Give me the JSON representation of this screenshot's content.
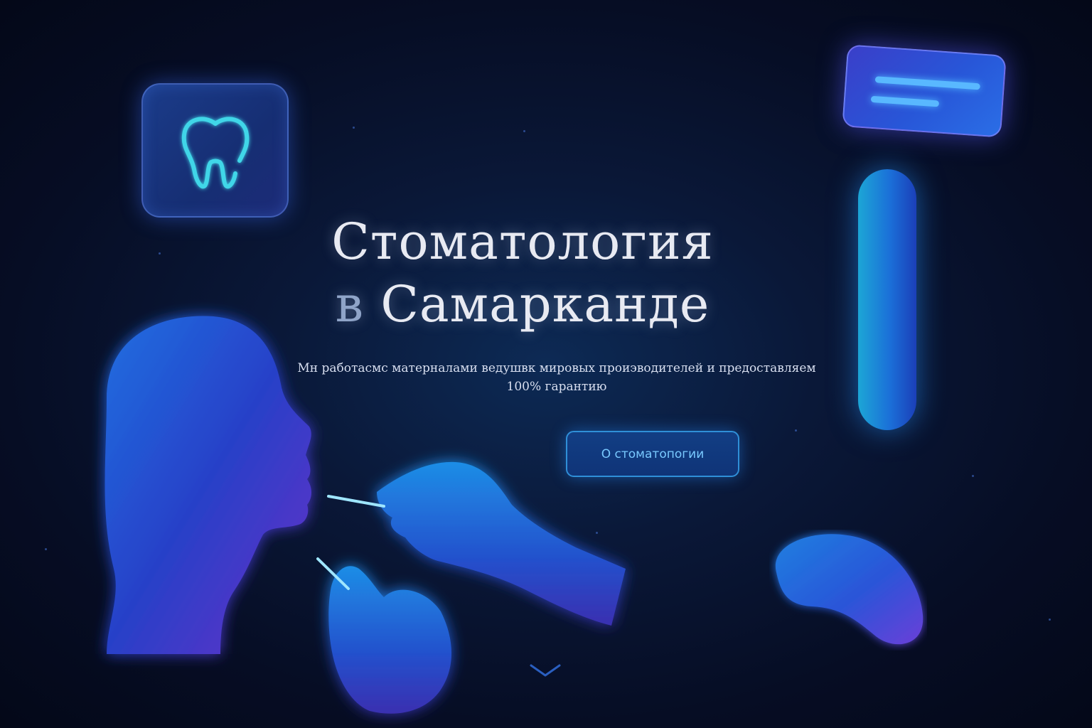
{
  "hero": {
    "title_line1": "Стоматология",
    "title_line2_prefix": "в",
    "title_line2_main": "Самарканде",
    "subtitle_line1": "Мн работасмс матерналами ведушвк мировых проиэводителей и предоставляем",
    "subtitle_line2": "100% гарантию",
    "cta_label": "О стоматопогии"
  },
  "icons": {
    "tooth": "tooth-icon",
    "card": "card-icon",
    "pill": "capsule-icon",
    "blob": "blob-shape",
    "scroll": "chevron-down-icon"
  },
  "colors": {
    "background": "#060d24",
    "accent_cyan": "#3fd6e8",
    "accent_blue": "#2f8fd8",
    "button_text": "#79c9ff",
    "title": "#e8eaf2"
  }
}
